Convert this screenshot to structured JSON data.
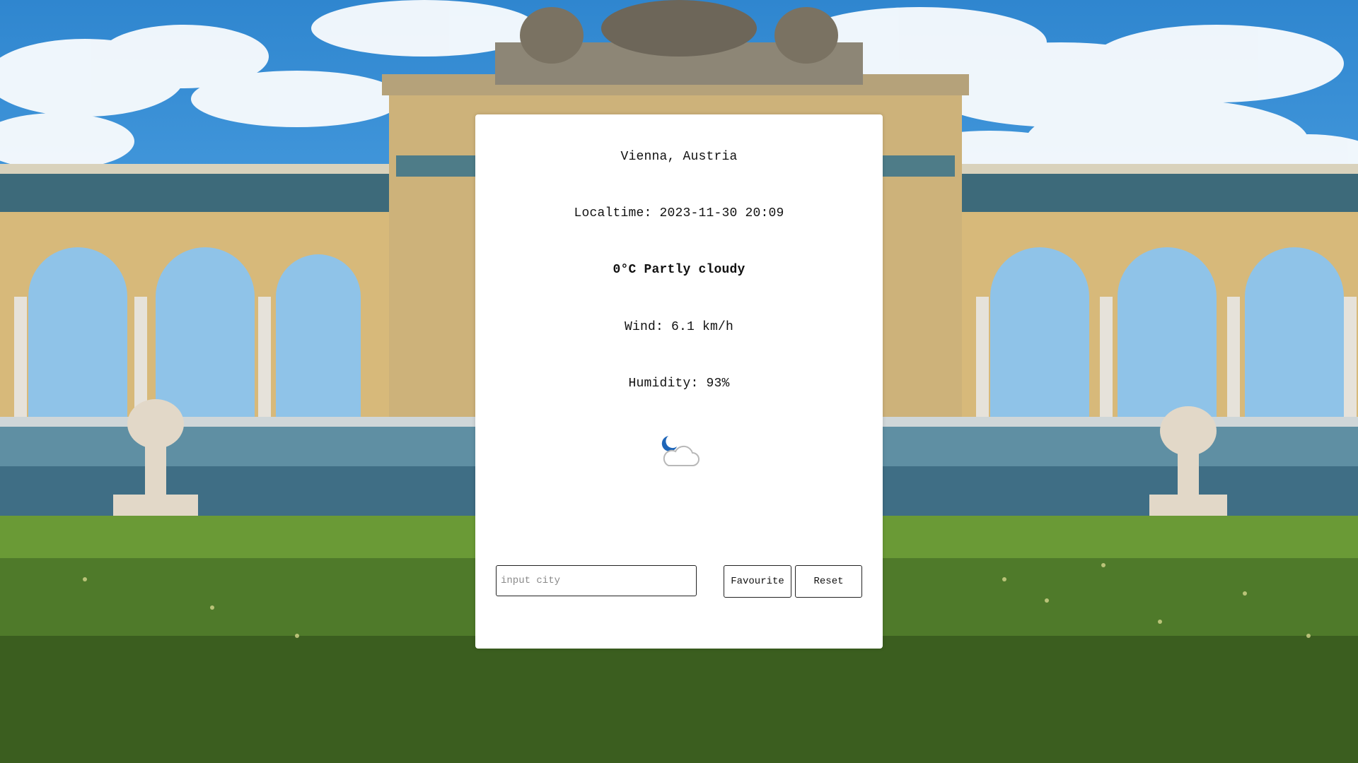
{
  "weather": {
    "location": "Vienna, Austria",
    "localtime": "Localtime: 2023-11-30 20:09",
    "condition": "0°C Partly cloudy",
    "wind": "Wind: 6.1 km/h",
    "humidity": "Humidity: 93%",
    "icon": "partly-cloudy-night-icon"
  },
  "search": {
    "placeholder": "input city",
    "value": ""
  },
  "buttons": {
    "favourite_label": "Favourite",
    "reset_label": "Reset"
  },
  "colors": {
    "card_background": "#ffffff",
    "icon_moon": "#1f66b8",
    "icon_cloud": "#b8b8b8"
  }
}
